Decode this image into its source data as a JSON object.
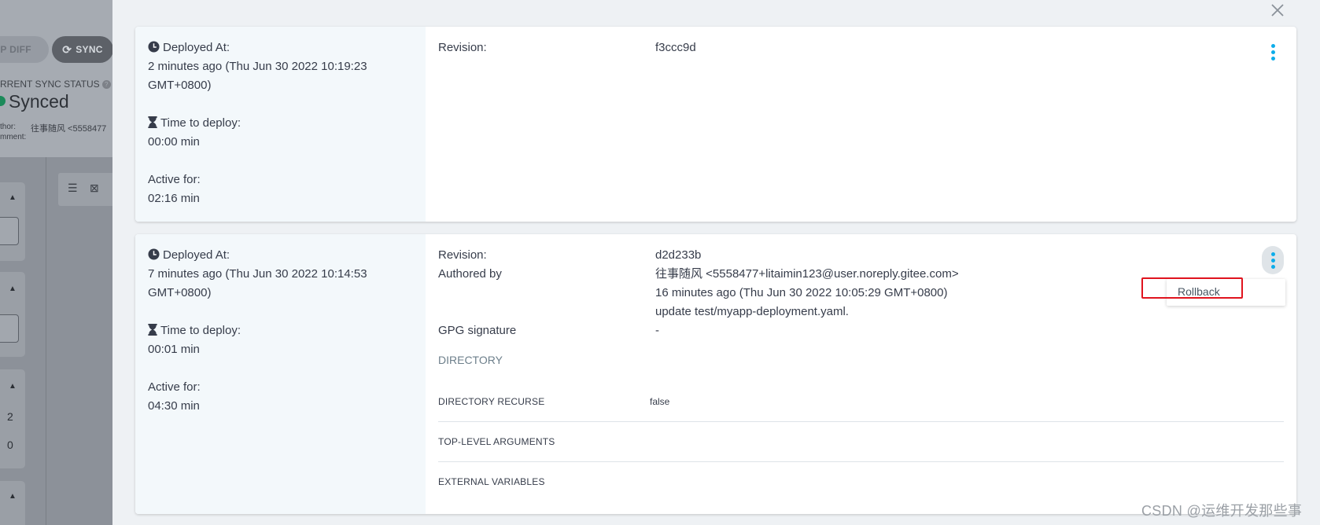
{
  "background_app": {
    "app_diff_label": "PP DIFF",
    "sync_label": "SYNC",
    "sync_status_label": "RRENT SYNC STATUS",
    "sync_status": "Synced",
    "author_label": "thor:",
    "author_value": "往事随风 <5558477",
    "comment_label": "mment:",
    "panel_numbers": [
      "2",
      "0"
    ]
  },
  "close_icon": "close-icon",
  "deployments": [
    {
      "deployed_at_label": "Deployed At:",
      "deployed_at_line1": "2 minutes ago (Thu Jun 30 2022 10:19:23",
      "deployed_at_line2": "GMT+0800)",
      "time_to_deploy_label": "Time to deploy:",
      "time_to_deploy": "00:00 min",
      "active_for_label": "Active for:",
      "active_for": "02:16 min",
      "revision_label": "Revision:",
      "revision": "f3ccc9d"
    },
    {
      "deployed_at_label": "Deployed At:",
      "deployed_at_line1": "7 minutes ago (Thu Jun 30 2022 10:14:53",
      "deployed_at_line2": "GMT+0800)",
      "time_to_deploy_label": "Time to deploy:",
      "time_to_deploy": "00:01 min",
      "active_for_label": "Active for:",
      "active_for": "04:30 min",
      "revision_label": "Revision:",
      "revision": "d2d233b",
      "authored_by_label": "Authored by",
      "author": "往事随风 <5558477+litaimin123@user.noreply.gitee.com>",
      "author_date": "16 minutes ago (Thu Jun 30 2022 10:05:29 GMT+0800)",
      "commit_message": "update test/myapp-deployment.yaml.",
      "gpg_label": "GPG signature",
      "gpg_value": "-",
      "directory_label": "DIRECTORY",
      "directory_recurse_label": "DIRECTORY RECURSE",
      "directory_recurse_value": "false",
      "top_level_args_label": "TOP-LEVEL ARGUMENTS",
      "external_vars_label": "EXTERNAL VARIABLES",
      "rollback_label": "Rollback"
    }
  ],
  "watermark": "CSDN @运维开发那些事",
  "colors": {
    "accent": "#0dadea",
    "highlight": "#e0141e",
    "synced": "#1c8a5a"
  }
}
